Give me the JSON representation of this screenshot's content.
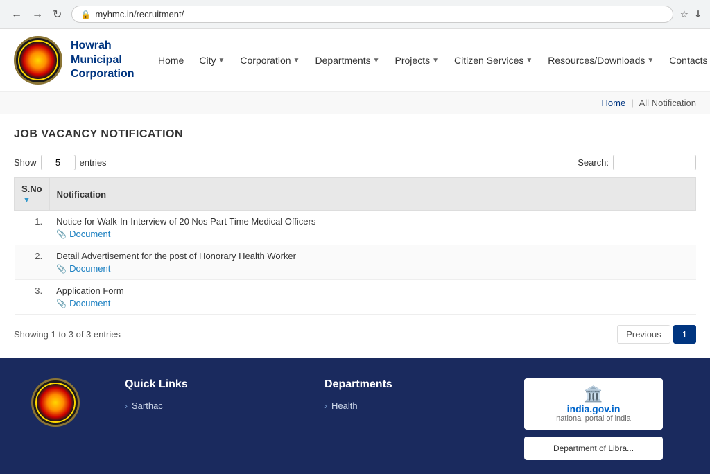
{
  "browser": {
    "url": "myhmc.in/recruitment/",
    "back_title": "Back",
    "forward_title": "Forward",
    "refresh_title": "Refresh"
  },
  "header": {
    "logo_org_line1": "Howrah",
    "logo_org_line2": "Municipal",
    "logo_org_line3": "Corporation",
    "nav_items": [
      {
        "label": "Home",
        "has_dropdown": false
      },
      {
        "label": "City",
        "has_dropdown": true
      },
      {
        "label": "Corporation",
        "has_dropdown": true
      },
      {
        "label": "Departments",
        "has_dropdown": true
      },
      {
        "label": "Projects",
        "has_dropdown": true
      },
      {
        "label": "Citizen Services",
        "has_dropdown": true
      },
      {
        "label": "Resources/Downloads",
        "has_dropdown": true
      },
      {
        "label": "Contacts",
        "has_dropdown": false
      }
    ]
  },
  "breadcrumb": {
    "home_label": "Home",
    "separator": "|",
    "current": "All Notification"
  },
  "main": {
    "page_title": "JOB VACANCY NOTIFICATION",
    "show_label": "Show",
    "entries_value": "5",
    "entries_label": "entries",
    "search_label": "Search:",
    "search_placeholder": "",
    "table_header_col1": "S.No",
    "table_header_col2": "Notification",
    "rows": [
      {
        "num": "1.",
        "title": "Notice for Walk-In-Interview of 20 Nos Part Time Medical Officers",
        "doc_label": "Document"
      },
      {
        "num": "2.",
        "title": "Detail Advertisement for the post of Honorary Health Worker",
        "doc_label": "Document"
      },
      {
        "num": "3.",
        "title": "Application Form",
        "doc_label": "Document"
      }
    ],
    "showing_text": "Showing 1 to 3 of 3 entries",
    "prev_btn": "Previous",
    "page_num": "1"
  },
  "footer": {
    "quick_links_title": "Quick Links",
    "quick_links": [
      {
        "label": "Sarthac"
      }
    ],
    "departments_title": "Departments",
    "departments": [
      {
        "label": "Health"
      }
    ],
    "india_gov_url": "india.gov.in",
    "india_gov_tagline": "national portal of india",
    "dept_lib_label": "Department of Libra..."
  }
}
